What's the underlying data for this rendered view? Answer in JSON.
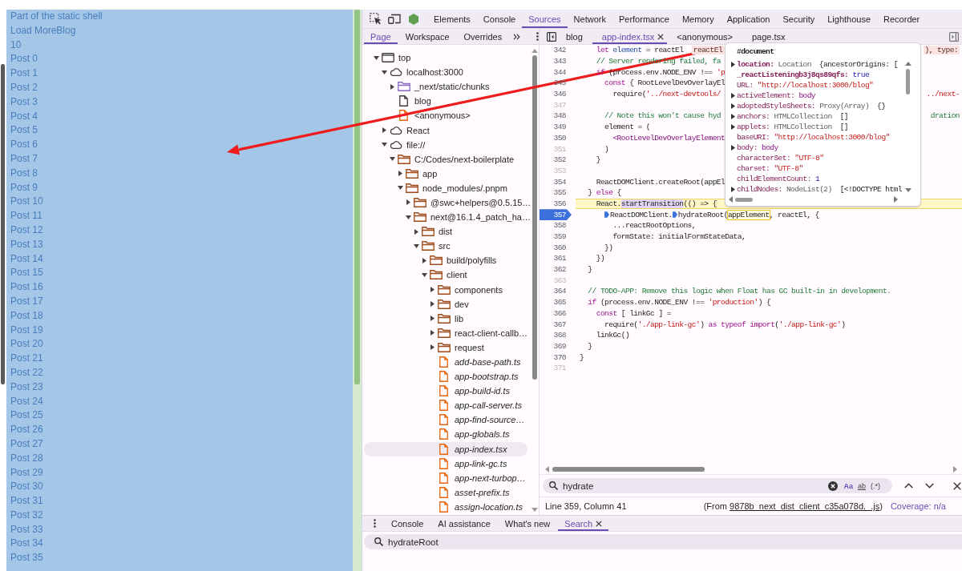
{
  "page": {
    "texts": [
      "Part of the static shell",
      "Load MoreBlog",
      "10"
    ],
    "posts": [
      "Post 0",
      "Post 1",
      "Post 2",
      "Post 3",
      "Post 4",
      "Post 5",
      "Post 6",
      "Post 7",
      "Post 8",
      "Post 9",
      "Post 10",
      "Post 11",
      "Post 12",
      "Post 13",
      "Post 14",
      "Post 15",
      "Post 16",
      "Post 17",
      "Post 18",
      "Post 19",
      "Post 20",
      "Post 21",
      "Post 22",
      "Post 23",
      "Post 24",
      "Post 25",
      "Post 26",
      "Post 27",
      "Post 28",
      "Post 29",
      "Post 30",
      "Post 31",
      "Post 32",
      "Post 33",
      "Post 34",
      "Post 35"
    ]
  },
  "devtools": {
    "panel_tabs": [
      {
        "label": "Elements",
        "selected": false
      },
      {
        "label": "Console",
        "selected": false
      },
      {
        "label": "Sources",
        "selected": true
      },
      {
        "label": "Network",
        "selected": false
      },
      {
        "label": "Performance",
        "selected": false
      },
      {
        "label": "Memory",
        "selected": false
      },
      {
        "label": "Application",
        "selected": false
      },
      {
        "label": "Security",
        "selected": false
      },
      {
        "label": "Lighthouse",
        "selected": false
      },
      {
        "label": "Recorder",
        "selected": false
      }
    ],
    "navigator_tabs": [
      {
        "label": "Page",
        "selected": true
      },
      {
        "label": "Workspace",
        "selected": false
      },
      {
        "label": "Overrides",
        "selected": false
      }
    ],
    "file_tabs": [
      {
        "label": "blog",
        "selected": false,
        "closable": false
      },
      {
        "label": "app-index.tsx",
        "selected": true,
        "closable": true
      },
      {
        "label": "<anonymous>",
        "selected": false,
        "closable": false
      },
      {
        "label": "page.tsx",
        "selected": false,
        "closable": false
      }
    ],
    "tree": [
      {
        "label": "top",
        "kind": "frame",
        "expanded": true,
        "selected": false,
        "children": [
          {
            "label": "localhost:3000",
            "kind": "domain",
            "expanded": true,
            "selected": false,
            "children": [
              {
                "label": "_next/static/chunks",
                "kind": "chunk-folder",
                "expanded": false,
                "selected": false
              },
              {
                "label": "blog",
                "kind": "document",
                "selected": false
              },
              {
                "label": "<anonymous>",
                "kind": "script",
                "selected": false
              }
            ]
          },
          {
            "label": "React",
            "kind": "domain",
            "expanded": false,
            "selected": false
          },
          {
            "label": "file://",
            "kind": "domain",
            "expanded": true,
            "selected": false,
            "children": [
              {
                "label": "C:/Codes/next-boilerplate",
                "kind": "folder",
                "expanded": true,
                "selected": false,
                "children": [
                  {
                    "label": "app",
                    "kind": "folder",
                    "expanded": false,
                    "selected": false
                  },
                  {
                    "label": "node_modules/.pnpm",
                    "kind": "folder",
                    "expanded": true,
                    "selected": false,
                    "children": [
                      {
                        "label": "@swc+helpers@0.5.15…",
                        "kind": "folder",
                        "expanded": false,
                        "selected": false
                      },
                      {
                        "label": "next@16.1.4_patch_ha…",
                        "kind": "folder",
                        "expanded": true,
                        "selected": false,
                        "children": [
                          {
                            "label": "dist",
                            "kind": "folder",
                            "expanded": false,
                            "selected": false
                          },
                          {
                            "label": "src",
                            "kind": "folder",
                            "expanded": true,
                            "selected": false,
                            "children": [
                              {
                                "label": "build/polyfills",
                                "kind": "folder",
                                "expanded": false,
                                "selected": false
                              },
                              {
                                "label": "client",
                                "kind": "folder",
                                "expanded": true,
                                "selected": false,
                                "children": [
                                  {
                                    "label": "components",
                                    "kind": "folder",
                                    "expanded": false,
                                    "selected": false
                                  },
                                  {
                                    "label": "dev",
                                    "kind": "folder",
                                    "expanded": false,
                                    "selected": false
                                  },
                                  {
                                    "label": "lib",
                                    "kind": "folder",
                                    "expanded": false,
                                    "selected": false
                                  },
                                  {
                                    "label": "react-client-callb…",
                                    "kind": "folder",
                                    "expanded": false,
                                    "selected": false
                                  },
                                  {
                                    "label": "request",
                                    "kind": "folder",
                                    "expanded": false,
                                    "selected": false
                                  },
                                  {
                                    "label": "add-base-path.ts",
                                    "kind": "source",
                                    "selected": false
                                  },
                                  {
                                    "label": "app-bootstrap.ts",
                                    "kind": "source",
                                    "selected": false
                                  },
                                  {
                                    "label": "app-build-id.ts",
                                    "kind": "source",
                                    "selected": false
                                  },
                                  {
                                    "label": "app-call-server.ts",
                                    "kind": "source",
                                    "selected": false
                                  },
                                  {
                                    "label": "app-find-source…",
                                    "kind": "source",
                                    "selected": false
                                  },
                                  {
                                    "label": "app-globals.ts",
                                    "kind": "source",
                                    "selected": false
                                  },
                                  {
                                    "label": "app-index.tsx",
                                    "kind": "source",
                                    "selected": true
                                  },
                                  {
                                    "label": "app-link-gc.ts",
                                    "kind": "source",
                                    "selected": false
                                  },
                                  {
                                    "label": "app-next-turbop…",
                                    "kind": "source",
                                    "selected": false
                                  },
                                  {
                                    "label": "asset-prefix.ts",
                                    "kind": "source",
                                    "selected": false
                                  },
                                  {
                                    "label": "assign-location.ts",
                                    "kind": "source",
                                    "selected": false
                                  }
                                ]
                              }
                            ]
                          }
                        ]
                      }
                    ]
                  }
                ]
              }
            ]
          }
        ]
      }
    ],
    "editor": {
      "lines": [
        {
          "number": "342",
          "breakable": true,
          "highlighted": false,
          "breakpoint": false,
          "segments": [
            {
              "text": "    let",
              "kind": "keyword"
            },
            {
              "text": " element",
              "kind": "variable"
            },
            {
              "text": " = reactEl  ",
              "kind": "plain"
            },
            {
              "text": "reactEl",
              "kind": "inline-value"
            }
          ],
          "tail": [
            {
              "text": "), type:",
              "kind": "inline-value"
            }
          ]
        },
        {
          "number": "343",
          "breakable": true,
          "highlighted": false,
          "breakpoint": false,
          "segments": [
            {
              "text": "    // Server rendering failed, fa",
              "kind": "comment"
            }
          ]
        },
        {
          "number": "344",
          "breakable": true,
          "highlighted": false,
          "breakpoint": false,
          "segments": [
            {
              "text": "    if",
              "kind": "keyword"
            },
            {
              "text": " (process.env.NODE_ENV !== ",
              "kind": "plain"
            },
            {
              "text": "'p",
              "kind": "string"
            }
          ]
        },
        {
          "number": "345",
          "breakable": true,
          "highlighted": false,
          "breakpoint": false,
          "segments": [
            {
              "text": "      const",
              "kind": "keyword"
            },
            {
              "text": " { RootLevelDevOverlayEl",
              "kind": "plain"
            }
          ]
        },
        {
          "number": "346",
          "breakable": true,
          "highlighted": false,
          "breakpoint": false,
          "segments": [
            {
              "text": "        require(",
              "kind": "plain"
            },
            {
              "text": "'../next-devtools/",
              "kind": "string"
            }
          ],
          "tail": [
            {
              "text": "../next-",
              "kind": "string"
            }
          ]
        },
        {
          "number": "347",
          "breakable": false,
          "highlighted": false,
          "breakpoint": false
        },
        {
          "number": "348",
          "breakable": true,
          "highlighted": false,
          "breakpoint": false,
          "segments": [
            {
              "text": "      // Note this won't cause hyd",
              "kind": "comment"
            }
          ],
          "tail": [
            {
              "text": "dration",
              "kind": "comment"
            }
          ]
        },
        {
          "number": "349",
          "breakable": true,
          "highlighted": false,
          "breakpoint": false,
          "segments": [
            {
              "text": "      element = (",
              "kind": "plain"
            }
          ]
        },
        {
          "number": "350",
          "breakable": true,
          "highlighted": false,
          "breakpoint": false,
          "segments": [
            {
              "text": "        <RootLevelDevOverlayElement",
              "kind": "tag"
            }
          ]
        },
        {
          "number": "351",
          "breakable": false,
          "highlighted": false,
          "breakpoint": false,
          "segments": [
            {
              "text": "      )",
              "kind": "plain"
            }
          ]
        },
        {
          "number": "352",
          "breakable": true,
          "highlighted": false,
          "breakpoint": false,
          "segments": [
            {
              "text": "    }",
              "kind": "plain"
            }
          ]
        },
        {
          "number": "353",
          "breakable": false,
          "highlighted": false,
          "breakpoint": false
        },
        {
          "number": "354",
          "breakable": true,
          "highlighted": false,
          "breakpoint": false,
          "segments": [
            {
              "text": "    ReactDOMClient.createRoot(appEl",
              "kind": "plain"
            }
          ]
        },
        {
          "number": "355",
          "breakable": true,
          "highlighted": false,
          "breakpoint": false,
          "segments": [
            {
              "text": "  } ",
              "kind": "plain"
            },
            {
              "text": "else",
              "kind": "keyword"
            },
            {
              "text": " {",
              "kind": "plain"
            }
          ]
        },
        {
          "number": "356",
          "breakable": true,
          "highlighted": true,
          "breakpoint": false,
          "segments": [
            {
              "text": "    React.",
              "kind": "plain"
            },
            {
              "text": "startTransition",
              "kind": "hover"
            },
            {
              "text": "(() => {",
              "kind": "plain"
            }
          ]
        },
        {
          "number": "357",
          "breakable": true,
          "highlighted": false,
          "breakpoint": true,
          "segments": [
            {
              "text": "      ReactDOMClient.",
              "kind": "plain",
              "marker": true
            },
            {
              "text": "hydrateRoot(",
              "kind": "plain",
              "marker": true
            },
            {
              "text": "appElement",
              "kind": "match",
              "marker": false
            },
            {
              "text": ", reactEl, {",
              "kind": "plain",
              "marker": false
            }
          ]
        },
        {
          "number": "358",
          "breakable": true,
          "highlighted": false,
          "breakpoint": false,
          "segments": [
            {
              "text": "        ...reactRootOptions,",
              "kind": "plain"
            }
          ]
        },
        {
          "number": "359",
          "breakable": true,
          "highlighted": false,
          "breakpoint": false,
          "segments": [
            {
              "text": "        formState: initialFormStateData,",
              "kind": "plain"
            }
          ]
        },
        {
          "number": "360",
          "breakable": true,
          "highlighted": false,
          "breakpoint": false,
          "segments": [
            {
              "text": "      })",
              "kind": "plain"
            }
          ]
        },
        {
          "number": "361",
          "breakable": true,
          "highlighted": false,
          "breakpoint": false,
          "segments": [
            {
              "text": "    })",
              "kind": "plain"
            }
          ]
        },
        {
          "number": "362",
          "breakable": true,
          "highlighted": false,
          "breakpoint": false,
          "segments": [
            {
              "text": "  }",
              "kind": "plain"
            }
          ]
        },
        {
          "number": "363",
          "breakable": false,
          "highlighted": false,
          "breakpoint": false
        },
        {
          "number": "364",
          "breakable": true,
          "highlighted": false,
          "breakpoint": false,
          "segments": [
            {
              "text": "  // TODO-APP: Remove this logic when Float has GC built-in in development.",
              "kind": "comment"
            }
          ]
        },
        {
          "number": "365",
          "breakable": true,
          "highlighted": false,
          "breakpoint": false,
          "segments": [
            {
              "text": "  if",
              "kind": "keyword"
            },
            {
              "text": " (process.env.NODE_ENV !== ",
              "kind": "plain"
            },
            {
              "text": "'production'",
              "kind": "string"
            },
            {
              "text": ") {",
              "kind": "plain"
            }
          ]
        },
        {
          "number": "366",
          "breakable": true,
          "highlighted": false,
          "breakpoint": false,
          "segments": [
            {
              "text": "    const",
              "kind": "keyword"
            },
            {
              "text": " [ linkGc ] =",
              "kind": "plain"
            }
          ]
        },
        {
          "number": "367",
          "breakable": true,
          "highlighted": false,
          "breakpoint": false,
          "segments": [
            {
              "text": "      require(",
              "kind": "plain"
            },
            {
              "text": "'./app-link-gc'",
              "kind": "string"
            },
            {
              "text": ") ",
              "kind": "plain"
            },
            {
              "text": "as typeof import",
              "kind": "keyword"
            },
            {
              "text": "(",
              "kind": "plain"
            },
            {
              "text": "'./app-link-gc'",
              "kind": "string"
            },
            {
              "text": ")",
              "kind": "plain"
            }
          ]
        },
        {
          "number": "368",
          "breakable": true,
          "highlighted": false,
          "breakpoint": false,
          "segments": [
            {
              "text": "    linkGc()",
              "kind": "plain"
            }
          ]
        },
        {
          "number": "369",
          "breakable": true,
          "highlighted": false,
          "breakpoint": false,
          "segments": [
            {
              "text": "  }",
              "kind": "plain"
            }
          ]
        },
        {
          "number": "370",
          "breakable": true,
          "highlighted": false,
          "breakpoint": false,
          "segments": [
            {
              "text": "}",
              "kind": "plain"
            }
          ]
        },
        {
          "number": "371",
          "breakable": false,
          "highlighted": false,
          "breakpoint": false
        }
      ]
    },
    "popup": {
      "title": "#document",
      "properties": [
        {
          "key": "location:",
          "value": "Location",
          "kind": "object",
          "preview": "{ancestorOrigins: [",
          "expandable": true,
          "own": true
        },
        {
          "key": "_reactListeningb3j8qs89qfs:",
          "value": "true",
          "kind": "boolean",
          "expandable": false,
          "own": true
        },
        {
          "key": "URL:",
          "value": "\"http://localhost:3000/blog\"",
          "kind": "string",
          "expandable": false,
          "own": false
        },
        {
          "key": "activeElement:",
          "value": "body",
          "kind": "node",
          "expandable": true,
          "own": false
        },
        {
          "key": "adoptedStyleSheets:",
          "value": "Proxy(Array)",
          "kind": "object",
          "preview": "{}",
          "expandable": true,
          "own": false
        },
        {
          "key": "anchors:",
          "value": "HTMLCollection",
          "kind": "object",
          "preview": "[]",
          "expandable": true,
          "own": false
        },
        {
          "key": "applets:",
          "value": "HTMLCollection",
          "kind": "object",
          "preview": "[]",
          "expandable": true,
          "own": false
        },
        {
          "key": "baseURI:",
          "value": "\"http://localhost:3000/blog\"",
          "kind": "string",
          "expandable": false,
          "own": false
        },
        {
          "key": "body:",
          "value": "body",
          "kind": "node",
          "expandable": true,
          "own": false
        },
        {
          "key": "characterSet:",
          "value": "\"UTF-8\"",
          "kind": "string",
          "expandable": false,
          "own": false
        },
        {
          "key": "charset:",
          "value": "\"UTF-8\"",
          "kind": "string",
          "expandable": false,
          "own": false
        },
        {
          "key": "childElementCount:",
          "value": "1",
          "kind": "number",
          "expandable": false,
          "own": false
        },
        {
          "key": "childNodes:",
          "value": "NodeList(2)",
          "kind": "object",
          "preview": "[<!DOCTYPE html",
          "expandable": true,
          "own": false
        }
      ]
    },
    "search": {
      "value": "hydrate",
      "options": [
        {
          "label": "Aa",
          "kind": "match-case",
          "on": true
        },
        {
          "label": "ab",
          "kind": "whole-word",
          "on": false
        },
        {
          "label": "(.*)",
          "kind": "regex",
          "on": false
        }
      ]
    },
    "status": {
      "position": "Line 359, Column 41",
      "source_prefix": "(From ",
      "source_link": "9878b_next_dist_client_c35a078d._.js",
      "source_suffix": ")",
      "coverage": "Coverage: n/a"
    },
    "drawer": {
      "tabs": [
        {
          "label": "Console",
          "selected": false,
          "closable": false
        },
        {
          "label": "AI assistance",
          "selected": false,
          "closable": false
        },
        {
          "label": "What's new",
          "selected": false,
          "closable": false
        },
        {
          "label": "Search",
          "selected": true,
          "closable": true
        }
      ],
      "search": {
        "value": "hydrateRoot"
      }
    }
  }
}
